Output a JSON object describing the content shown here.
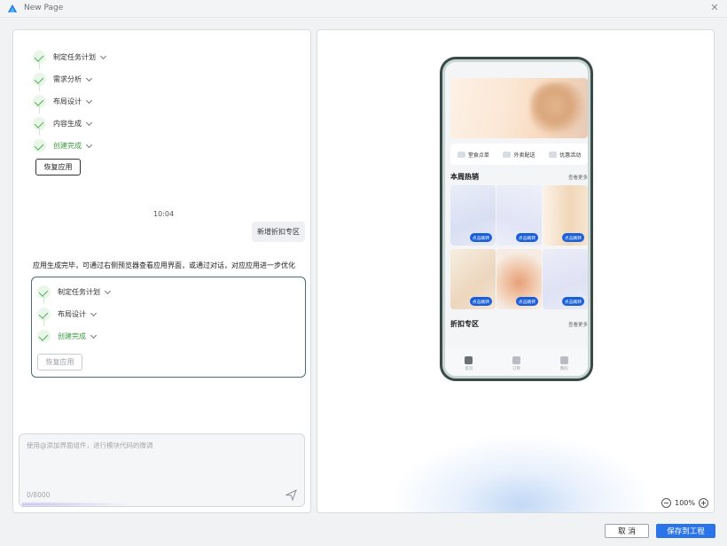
{
  "window": {
    "title": "New Page",
    "close_icon": "close-icon"
  },
  "chat": {
    "steps_first": [
      {
        "label": "制定任务计划",
        "done": false
      },
      {
        "label": "需求分析",
        "done": false
      },
      {
        "label": "布局设计",
        "done": false
      },
      {
        "label": "内容生成",
        "done": false
      },
      {
        "label": "创建完成",
        "done": true
      }
    ],
    "restore_label": "恢复应用",
    "time": "10:04",
    "user_message": "新增折扣专区",
    "reply": "应用生成完毕，可通过右侧预览器查看应用界面，或通过对话，对应应用进一步优化",
    "steps_second": [
      {
        "label": "制定任务计划",
        "done": false
      },
      {
        "label": "布局设计",
        "done": false
      },
      {
        "label": "创建完成",
        "done": true
      }
    ],
    "restore_label_2": "恢复应用",
    "input_placeholder": "使用@添加界面组件，进行模块代码的微调",
    "input_count": "0/8000"
  },
  "preview": {
    "chips": [
      "堂食点单",
      "外卖配送",
      "优惠活动"
    ],
    "section1_title": "本周热销",
    "section2_title": "折扣专区",
    "more_label": "查看更多",
    "jump_label": "点击跳转",
    "tabs": [
      "首页",
      "订单",
      "我的"
    ],
    "zoom": "100%"
  },
  "footer": {
    "cancel_label": "取 消",
    "save_label": "保存到工程"
  },
  "colors": {
    "accent": "#2b73e8",
    "success": "#4caf50",
    "jump": "#1a5fd8"
  }
}
